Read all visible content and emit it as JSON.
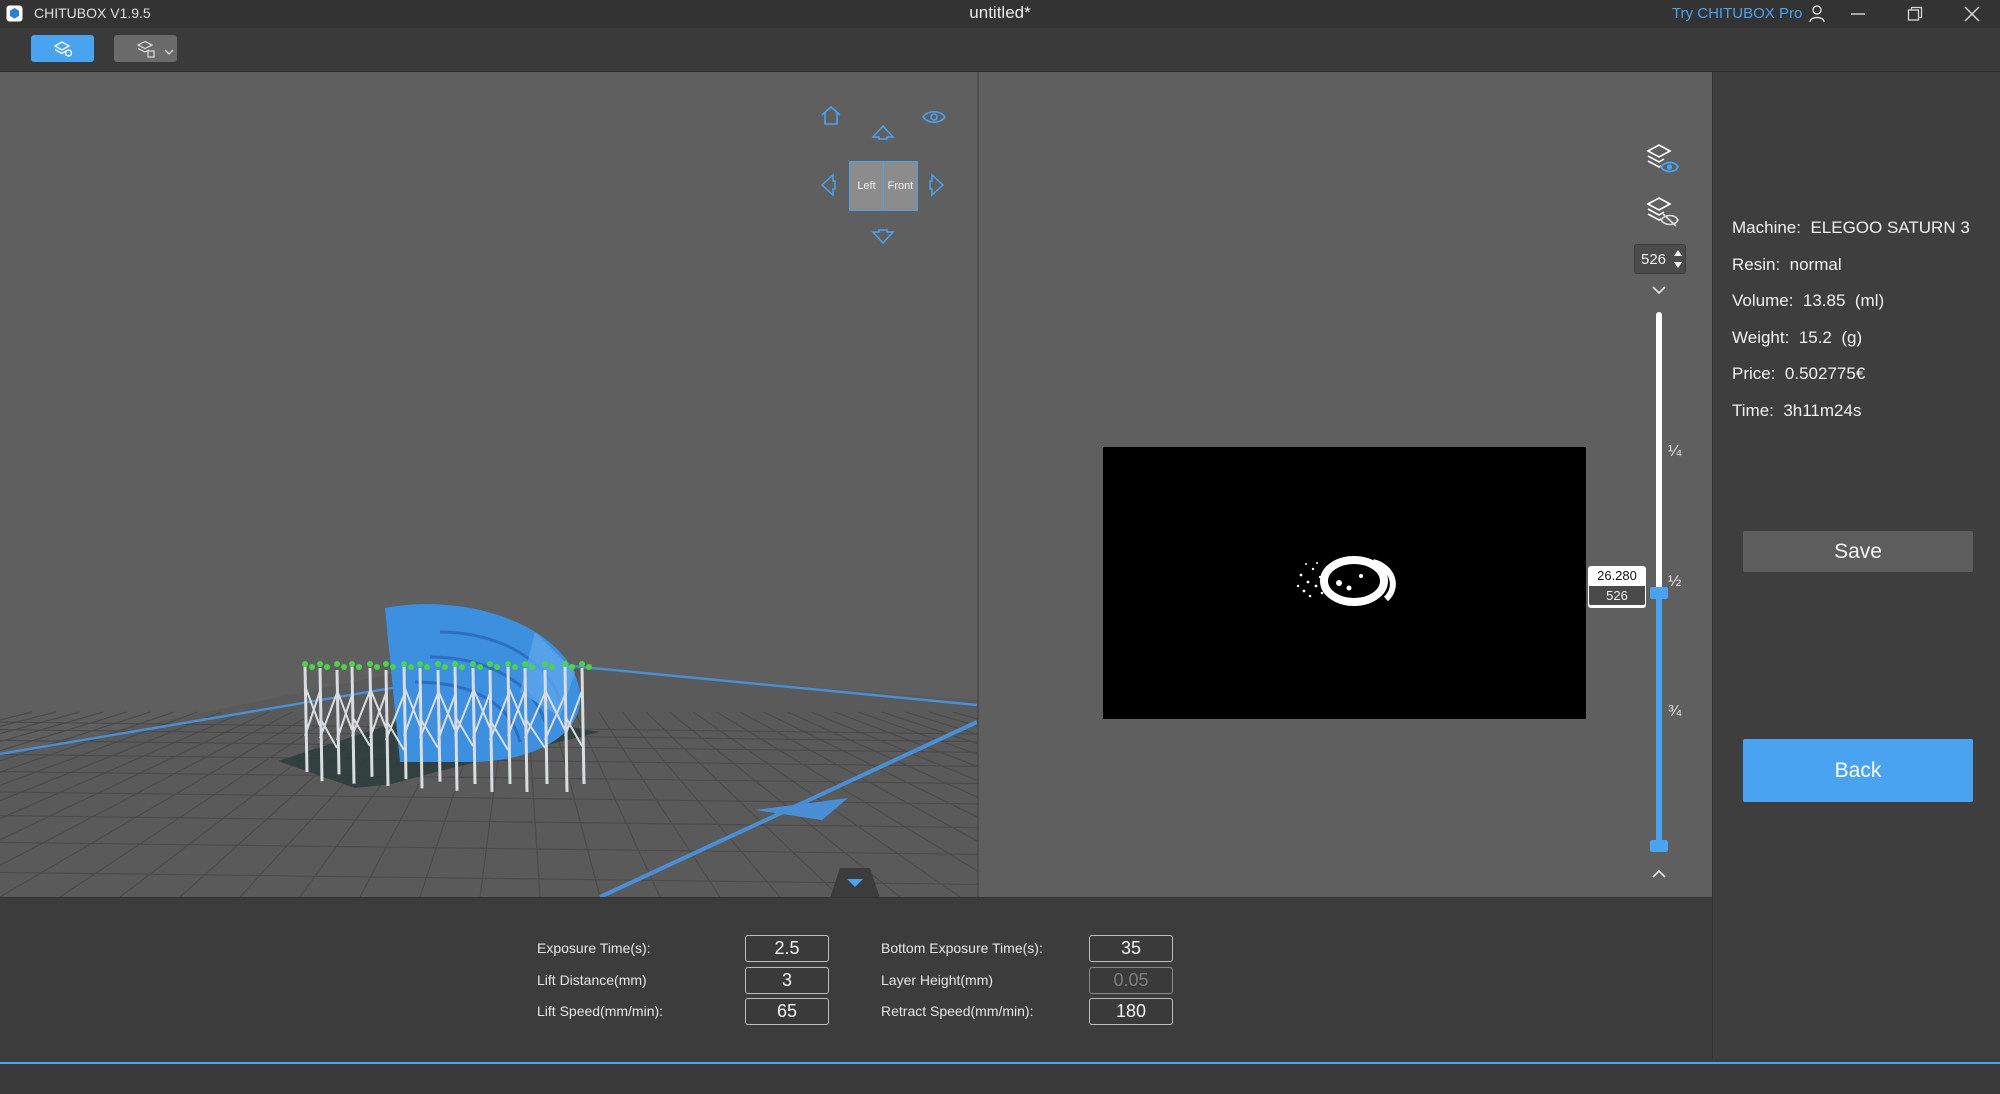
{
  "app": {
    "name": "CHITUBOX V1.9.5",
    "document_title": "untitled*",
    "try_pro": "Try CHITUBOX Pro"
  },
  "viewport": {
    "nav_cube": {
      "left_face": "Left",
      "front_face": "Front"
    }
  },
  "slice_view": {
    "current_layer": "526",
    "tooltip_height": "26.280",
    "tooltip_layer": "526",
    "fractions": [
      "¼",
      "½",
      "¾"
    ],
    "position_fraction": 0.5
  },
  "info": {
    "machine_label": "Machine:",
    "machine_value": "ELEGOO SATURN 3",
    "resin_label": "Resin:",
    "resin_value": "normal",
    "volume_label": "Volume:",
    "volume_value": "13.85",
    "volume_unit": "(ml)",
    "weight_label": "Weight:",
    "weight_value": "15.2",
    "weight_unit": "(g)",
    "price_label": "Price:",
    "price_value": "0.502775€",
    "time_label": "Time:",
    "time_value": "3h11m24s",
    "save_label": "Save",
    "back_label": "Back"
  },
  "params": {
    "exposure_time_label": "Exposure Time(s):",
    "exposure_time_value": "2.5",
    "lift_distance_label": "Lift Distance(mm)",
    "lift_distance_value": "3",
    "lift_speed_label": "Lift Speed(mm/min):",
    "lift_speed_value": "65",
    "bottom_exposure_label": "Bottom Exposure Time(s):",
    "bottom_exposure_value": "35",
    "layer_height_label": "Layer Height(mm)",
    "layer_height_value": "0.05",
    "retract_speed_label": "Retract Speed(mm/min):",
    "retract_speed_value": "180"
  },
  "colors": {
    "accent": "#4aa3f0",
    "model": "#3d8fe0",
    "supports": "#d9dde0",
    "contact_points": "#4cd34c"
  },
  "icons": {
    "logo": "chitubox-logo-icon",
    "user": "user-icon",
    "minimize": "minimize-icon",
    "restore": "restore-icon",
    "close": "close-icon"
  }
}
